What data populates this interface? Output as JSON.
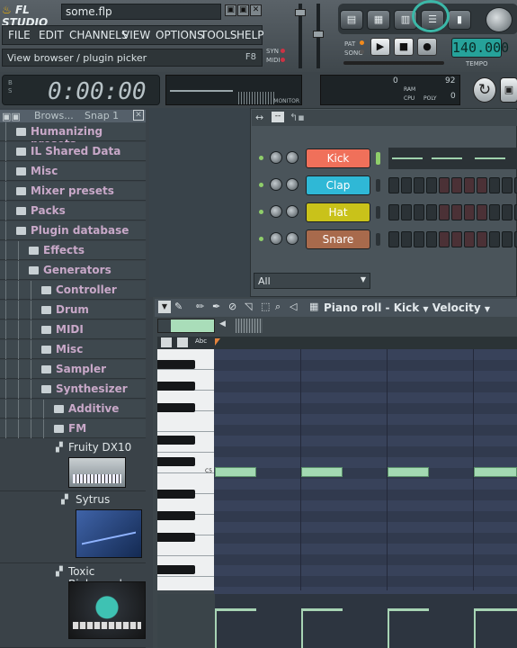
{
  "app": {
    "title": "FL STUDIO",
    "filename": "some.flp"
  },
  "window_buttons": [
    "▣",
    "▣",
    "✕"
  ],
  "menu": [
    "FILE",
    "EDIT",
    "CHANNELS",
    "VIEW",
    "OPTIONS",
    "TOOLS",
    "HELP"
  ],
  "hint": {
    "text": "View browser / plugin picker",
    "key": "F8"
  },
  "syn_midi": [
    "SYN",
    "MIDI"
  ],
  "pat_song": [
    "PAT",
    "SONG"
  ],
  "transport": {
    "play": "▶",
    "stop": "■",
    "record": "●",
    "tempo": "140.000",
    "tempo_label": "TEMPO"
  },
  "time_display": {
    "time": "0:00:00",
    "bpm_label": "B",
    "s_label": "S"
  },
  "monitor_label": "MONITOR",
  "cpu": {
    "top_left": "0",
    "top_right": "92",
    "ram_label": "RAM",
    "cpu_label": "CPU",
    "poly_label": "POLY",
    "poly_value": "0"
  },
  "browser": {
    "header": "Brows...",
    "snap": "Snap 1",
    "items": [
      {
        "label": "Humanizing presets",
        "indent": 0
      },
      {
        "label": "IL Shared Data",
        "indent": 0
      },
      {
        "label": "Misc",
        "indent": 0
      },
      {
        "label": "Mixer presets",
        "indent": 0
      },
      {
        "label": "Packs",
        "indent": 0
      },
      {
        "label": "Plugin database",
        "indent": 0
      },
      {
        "label": "Effects",
        "indent": 1
      },
      {
        "label": "Generators",
        "indent": 1
      },
      {
        "label": "Controller",
        "indent": 2
      },
      {
        "label": "Drum",
        "indent": 2
      },
      {
        "label": "MIDI",
        "indent": 2
      },
      {
        "label": "Misc",
        "indent": 2
      },
      {
        "label": "Sampler",
        "indent": 2
      },
      {
        "label": "Synthesizer",
        "indent": 2
      },
      {
        "label": "Additive",
        "indent": 3
      },
      {
        "label": "FM",
        "indent": 3
      }
    ],
    "plugins": [
      "Fruity DX10",
      "Sytrus",
      "Toxic Biohazard"
    ]
  },
  "channels": [
    {
      "name": "Kick",
      "color": "#f0705a"
    },
    {
      "name": "Clap",
      "color": "#2fb8d6"
    },
    {
      "name": "Hat",
      "color": "#c9c21a"
    },
    {
      "name": "Snare",
      "color": "#a86a4c"
    }
  ],
  "channel_filter": "All",
  "piano_roll": {
    "title": "Piano roll - Kick",
    "mode": "Velocity",
    "note_label": "C5"
  },
  "colors": {
    "accent": "#3bb8a8",
    "note": "#a3d9b2"
  }
}
